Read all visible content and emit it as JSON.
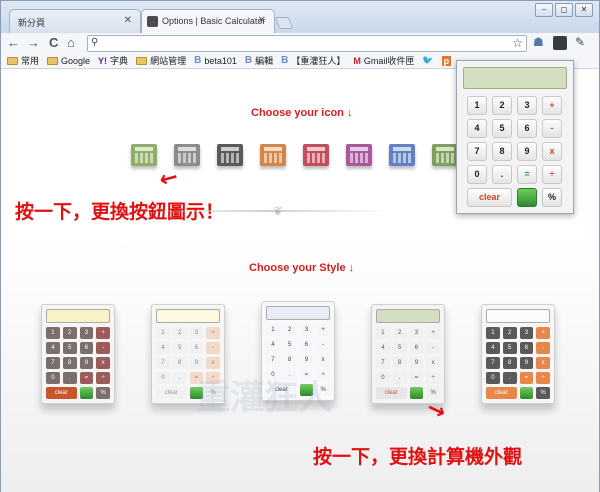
{
  "tabs": [
    {
      "label": "新分頁",
      "active": false
    },
    {
      "label": "Options | Basic Calculator",
      "active": true
    }
  ],
  "window_controls": [
    "–",
    "◻",
    "✕"
  ],
  "toolbar": {
    "back": "←",
    "forward": "→",
    "reload": "C",
    "home": "⌂",
    "search_icon": "search-icon",
    "star": "☆"
  },
  "bookmarks": [
    {
      "label": "常用",
      "icon": "folder"
    },
    {
      "label": "Google",
      "icon": "folder"
    },
    {
      "label": "字典",
      "icon": "yahoo",
      "prefix": "Y!"
    },
    {
      "label": "網站管理",
      "icon": "folder"
    },
    {
      "label": "beta101",
      "icon": "b",
      "prefix": "B"
    },
    {
      "label": "編輯",
      "icon": "b",
      "prefix": "B"
    },
    {
      "label": "【重灌狂人】",
      "icon": "b",
      "prefix": "B"
    },
    {
      "label": "Gmail收件匣",
      "icon": "m",
      "prefix": "M"
    }
  ],
  "content": {
    "choose_icon": "Choose your icon ↓",
    "choose_style": "Choose your Style ↓",
    "annotation_icon": "按一下，更換按鈕圖示！",
    "annotation_style": "按一下，更換計算機外觀",
    "watermark": "重灌狂人"
  },
  "icon_colors": [
    "#8fae6a",
    "#8c8c8c",
    "#5a5a5a",
    "#d0874a",
    "#c44f5c",
    "#a85a9e",
    "#5f82c2",
    "#7ea05a"
  ],
  "styles": [
    {
      "name": "style-1",
      "bg": "#f5f5f5",
      "disp": "#f7f2c8",
      "key": "#7a6e6e",
      "key_text": "#fff",
      "op": "#9b5b5b",
      "clear": "#c8562b",
      "clear_text": "#fff"
    },
    {
      "name": "style-2",
      "bg": "#f6f6f6",
      "disp": "#fdf8e0",
      "key": "#f1f1f1",
      "key_text": "#888",
      "op": "#f3d9c7",
      "clear": "#f1f1f1",
      "clear_text": "#999"
    },
    {
      "name": "style-3",
      "bg": "#f8f8f8",
      "disp": "#e8ecf4",
      "key": "#f4f6fa",
      "key_text": "#444",
      "op": "#f4f6fa",
      "clear": "#f4f6fa",
      "clear_text": "#444"
    },
    {
      "name": "style-4",
      "bg": "#f4f4f4",
      "disp": "#d3ddbf",
      "key": "#f0f0f0",
      "key_text": "#555",
      "op": "#f0f0f0",
      "clear": "#e6e6e6",
      "clear_text": "#c8562b"
    },
    {
      "name": "style-5",
      "bg": "#f6f6f6",
      "disp": "#fbfbfb",
      "key": "#5a5a5a",
      "key_text": "#fff",
      "op": "#e8874a",
      "clear": "#e8874a",
      "clear_text": "#fff"
    }
  ],
  "keys": [
    "1",
    "2",
    "3",
    "+",
    "4",
    "5",
    "6",
    "-",
    "7",
    "8",
    "9",
    "x",
    "0",
    ".",
    "=",
    "÷"
  ],
  "popup": {
    "keys": [
      "1",
      "2",
      "3",
      "+",
      "4",
      "5",
      "6",
      "-",
      "7",
      "8",
      "9",
      "x",
      "0",
      ".",
      "=",
      "÷"
    ],
    "clear_label": "clear",
    "percent_label": "%"
  }
}
